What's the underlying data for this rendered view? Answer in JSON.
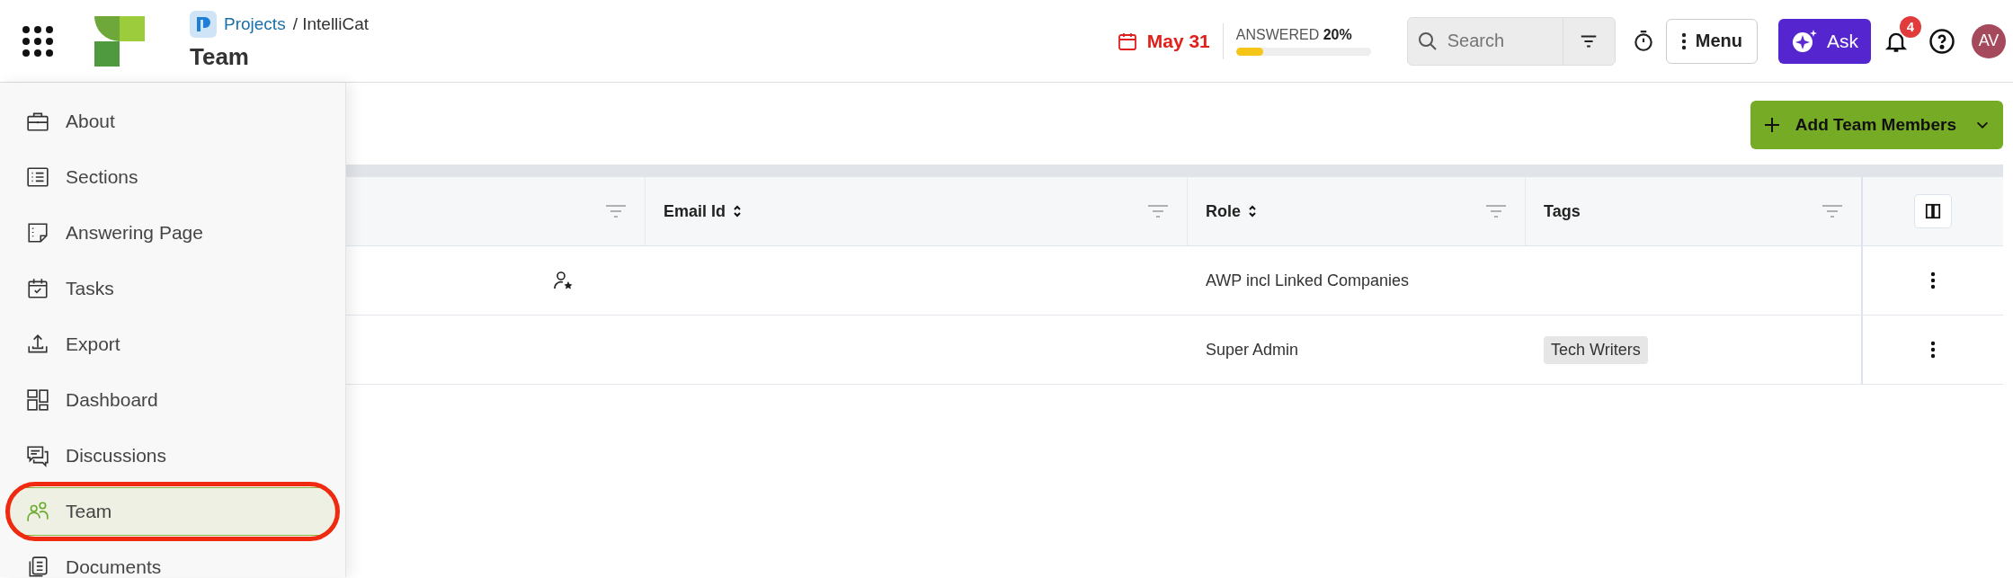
{
  "header": {
    "breadcrumb_link": "Projects",
    "breadcrumb_rest": "/ IntelliCat",
    "title": "Team",
    "due_date": "May 31",
    "progress": {
      "label": "ANSWERED",
      "value": "20%",
      "level": 0.2
    },
    "search": {
      "placeholder": "Search"
    },
    "menu_label": "Menu",
    "ask_label": "Ask",
    "notification_count": "4",
    "avatar_initials": "AV"
  },
  "sidebar": {
    "items": [
      {
        "label": "About",
        "kind": "briefcase",
        "selected": false
      },
      {
        "label": "Sections",
        "kind": "list",
        "selected": false
      },
      {
        "label": "Answering Page",
        "kind": "note",
        "selected": false
      },
      {
        "label": "Tasks",
        "kind": "calendar",
        "selected": false
      },
      {
        "label": "Export",
        "kind": "upload",
        "selected": false
      },
      {
        "label": "Dashboard",
        "kind": "dashboard",
        "selected": false
      },
      {
        "label": "Discussions",
        "kind": "chat",
        "selected": false
      },
      {
        "label": "Team",
        "kind": "people",
        "selected": true
      },
      {
        "label": "Documents",
        "kind": "documents",
        "selected": false
      }
    ]
  },
  "add_button": {
    "label": "Add Team Members"
  },
  "table": {
    "columns": [
      {
        "sortable": false,
        "filter": true
      },
      {
        "label": "Email Id",
        "sortable": true,
        "filter": true
      },
      {
        "label": "Role",
        "sortable": true,
        "filter": true
      },
      {
        "label": "Tags",
        "sortable": false,
        "filter": true
      }
    ],
    "rows": [
      {
        "owner": true,
        "role": "AWP incl Linked Companies"
      },
      {
        "owner": false,
        "role": "Super Admin",
        "tags": [
          "Tech Writers"
        ]
      }
    ]
  }
}
